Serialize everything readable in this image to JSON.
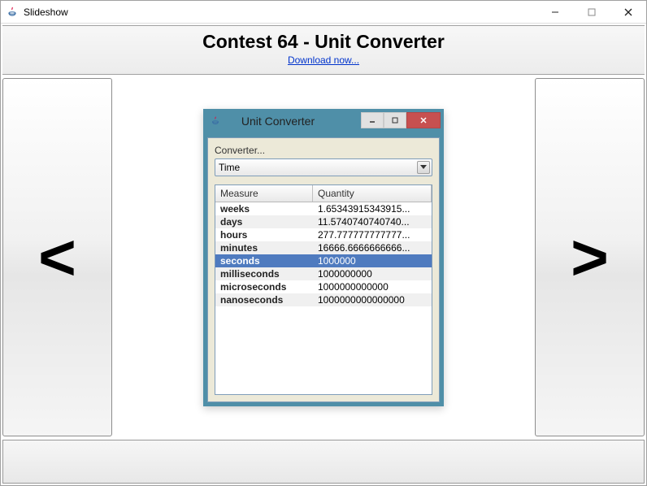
{
  "window": {
    "title": "Slideshow"
  },
  "header": {
    "title": "Contest 64 - Unit Converter",
    "download_link": "Download now..."
  },
  "nav": {
    "prev": "<",
    "next": ">"
  },
  "inner": {
    "title": "Unit Converter",
    "label": "Converter...",
    "combo_value": "Time",
    "columns": {
      "measure": "Measure",
      "quantity": "Quantity"
    },
    "rows": [
      {
        "measure": "weeks",
        "quantity": "1.65343915343915...",
        "selected": false
      },
      {
        "measure": "days",
        "quantity": "11.5740740740740...",
        "selected": false
      },
      {
        "measure": "hours",
        "quantity": "277.777777777777...",
        "selected": false
      },
      {
        "measure": "minutes",
        "quantity": "16666.6666666666...",
        "selected": false
      },
      {
        "measure": "seconds",
        "quantity": "1000000",
        "selected": true
      },
      {
        "measure": "milliseconds",
        "quantity": "1000000000",
        "selected": false
      },
      {
        "measure": "microseconds",
        "quantity": "1000000000000",
        "selected": false
      },
      {
        "measure": "nanoseconds",
        "quantity": "1000000000000000",
        "selected": false
      }
    ]
  }
}
